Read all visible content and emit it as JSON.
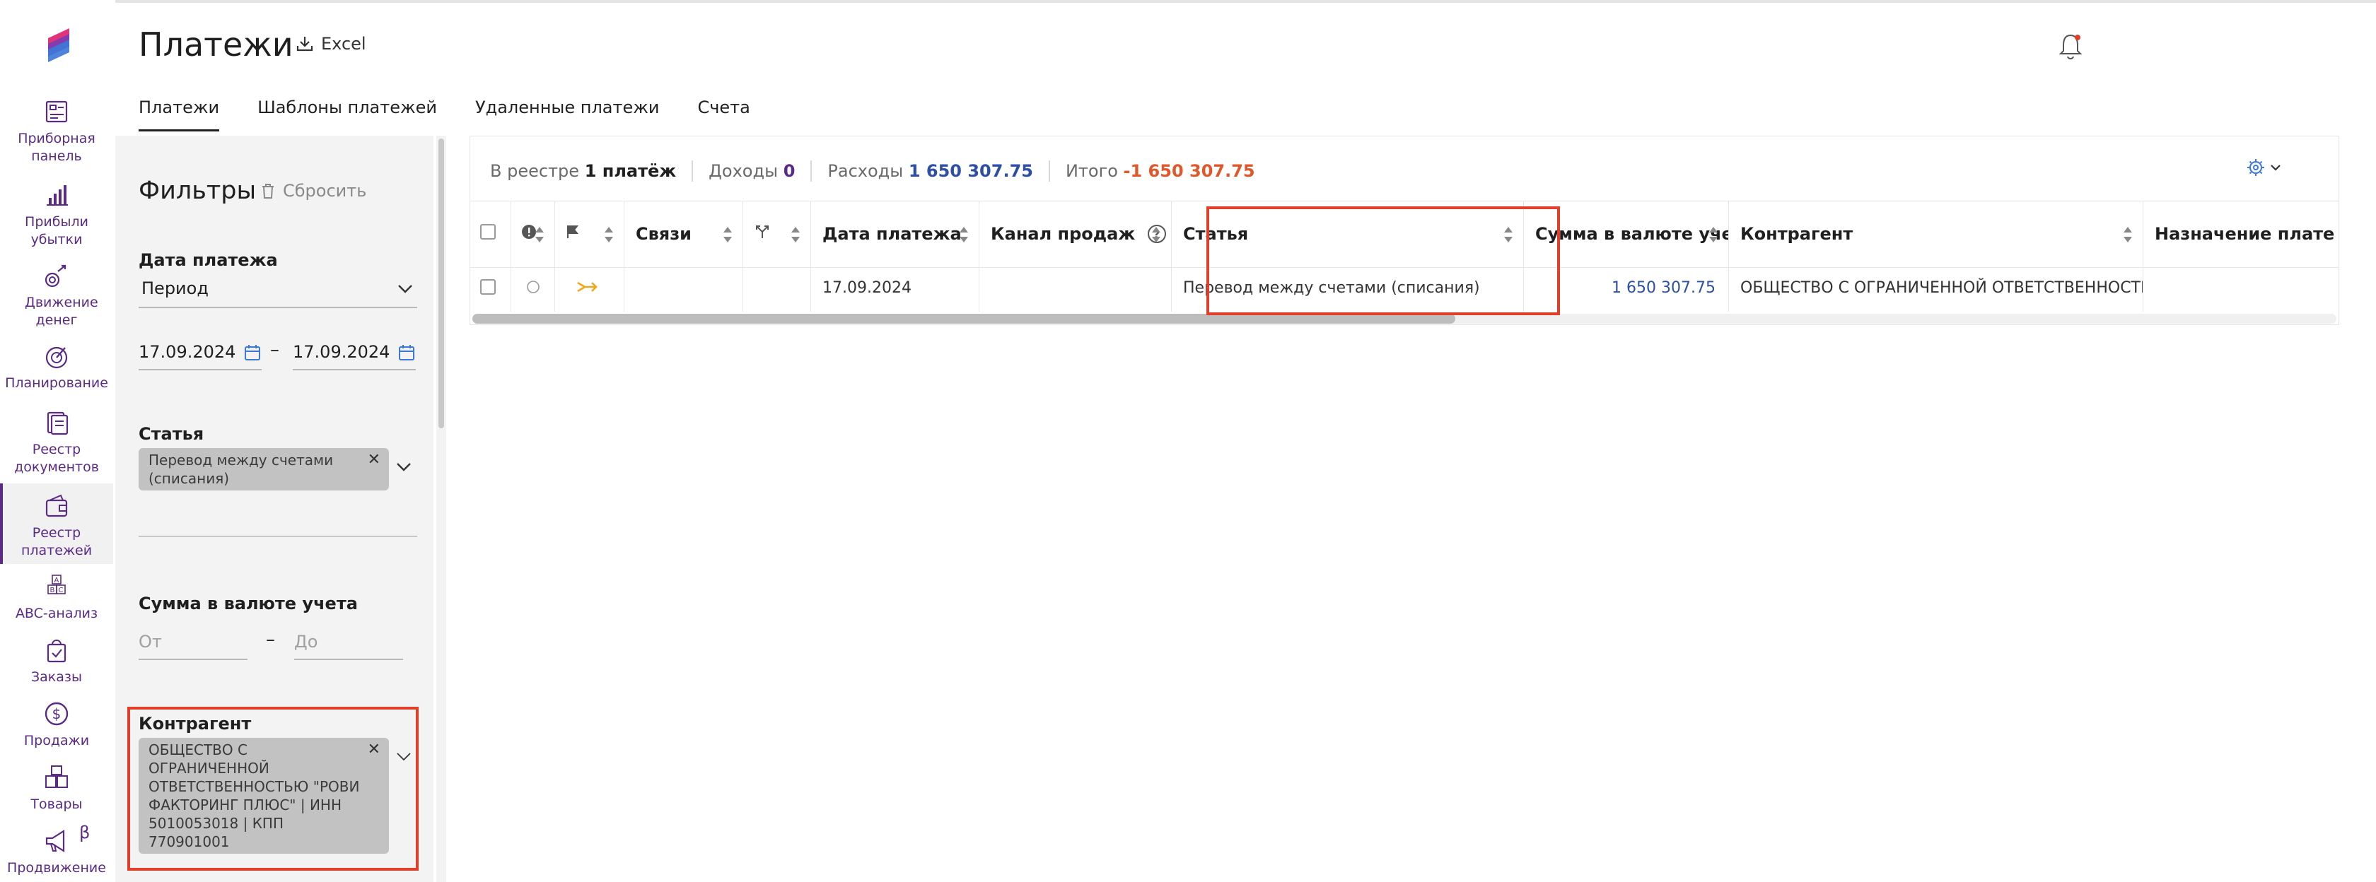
{
  "nav": {
    "items": [
      {
        "label": "Приборная панель"
      },
      {
        "label": "Прибыли убытки"
      },
      {
        "label": "Движение денег"
      },
      {
        "label": "Планирование"
      },
      {
        "label": "Реестр документов"
      },
      {
        "label": "Реестр платежей"
      },
      {
        "label": "ABC-анализ"
      },
      {
        "label": "Заказы"
      },
      {
        "label": "Продажи"
      },
      {
        "label": "Товары"
      },
      {
        "label": "Продвижение"
      }
    ],
    "beta": "β",
    "accent_color": "#5b2a86"
  },
  "header": {
    "title": "Платежи",
    "excel_label": "Excel"
  },
  "tabs": [
    {
      "label": "Платежи",
      "active": true
    },
    {
      "label": "Шаблоны платежей"
    },
    {
      "label": "Удаленные платежи"
    },
    {
      "label": "Счета"
    }
  ],
  "filters": {
    "title": "Фильтры",
    "reset_label": "Сбросить",
    "payment_date": {
      "label": "Дата платежа",
      "mode": "Период",
      "from": "17.09.2024",
      "to": "17.09.2024",
      "separator": "–"
    },
    "article": {
      "label": "Статья",
      "chip": "Перевод между счетами (списания)"
    },
    "amount": {
      "label": "Сумма в валюте учета",
      "from_placeholder": "От",
      "to_placeholder": "До",
      "separator": "–"
    },
    "counterparty": {
      "label": "Контрагент",
      "chip": "ОБЩЕСТВО С ОГРАНИЧЕННОЙ ОТВЕТСТВЕННОСТЬЮ \"РОВИ ФАКТОРИНГ ПЛЮС\" | ИНН 5010053018 | КПП 770901001"
    }
  },
  "summary": {
    "registry_label": "В реестре",
    "registry_value": "1 платёж",
    "income_label": "Доходы",
    "income_value": "0",
    "expense_label": "Расходы",
    "expense_value": "1 650 307.75",
    "total_label": "Итого",
    "total_value": "-1 650 307.75"
  },
  "table": {
    "columns": {
      "links": "Связи",
      "date": "Дата платежа",
      "channel": "Канал продаж",
      "article": "Статья",
      "amount": "Сумма в валюте учета",
      "counterparty": "Контрагент",
      "purpose": "Назначение плате"
    },
    "rows": [
      {
        "date": "17.09.2024",
        "channel": "",
        "article": "Перевод между счетами (списания)",
        "amount": "1 650 307.75",
        "counterparty": "ОБЩЕСТВО С ОГРАНИЧЕННОЙ ОТВЕТСТВЕННОСТЬЮ \"",
        "purpose": ""
      }
    ]
  }
}
